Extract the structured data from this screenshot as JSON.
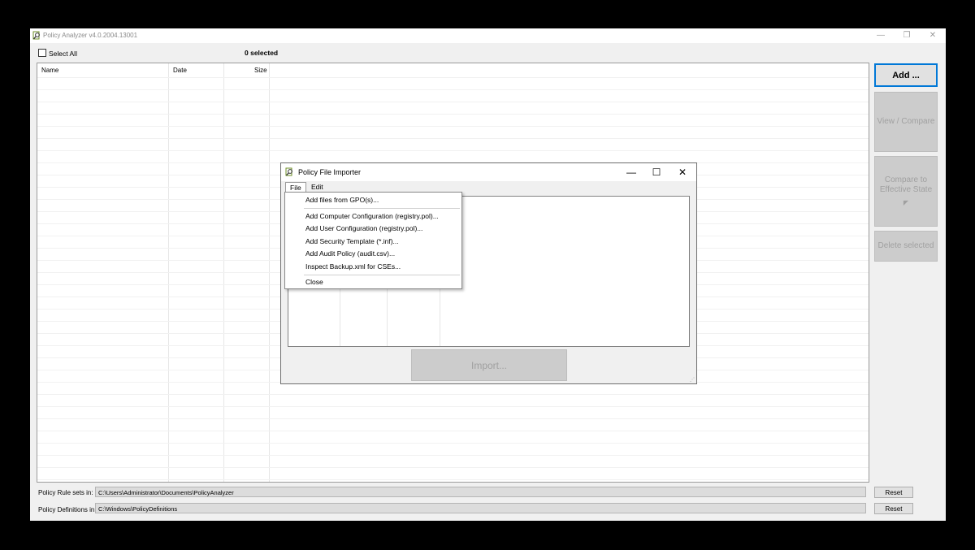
{
  "main_window": {
    "title": "Policy Analyzer v4.0.2004.13001",
    "controls": {
      "minimize": "—",
      "restore": "❐",
      "close": "✕"
    }
  },
  "toolbar": {
    "select_all_label": "Select All",
    "selected_count": "0 selected"
  },
  "table": {
    "columns": [
      "Name",
      "Date",
      "Size"
    ]
  },
  "side_buttons": {
    "add": "Add ...",
    "view_compare": "View / Compare",
    "compare_effective": "Compare to Effective State",
    "delete_selected": "Delete selected"
  },
  "footer": {
    "rule_sets_label": "Policy Rule sets in:",
    "rule_sets_path": "C:\\Users\\Administrator\\Documents\\PolicyAnalyzer",
    "definitions_label": "Policy Definitions in:",
    "definitions_path": "C:\\Windows\\PolicyDefinitions",
    "reset_label": "Reset"
  },
  "dialog": {
    "title": "Policy File Importer",
    "menu": [
      "File",
      "Edit"
    ],
    "import_button": "Import..."
  },
  "file_menu": {
    "items": [
      "Add files from GPO(s)...",
      "Add Computer Configuration (registry.pol)...",
      "Add User Configuration (registry.pol)...",
      "Add Security Template (*.inf)...",
      "Add Audit Policy (audit.csv)...",
      "Inspect Backup.xml for CSEs...",
      "Close"
    ]
  }
}
